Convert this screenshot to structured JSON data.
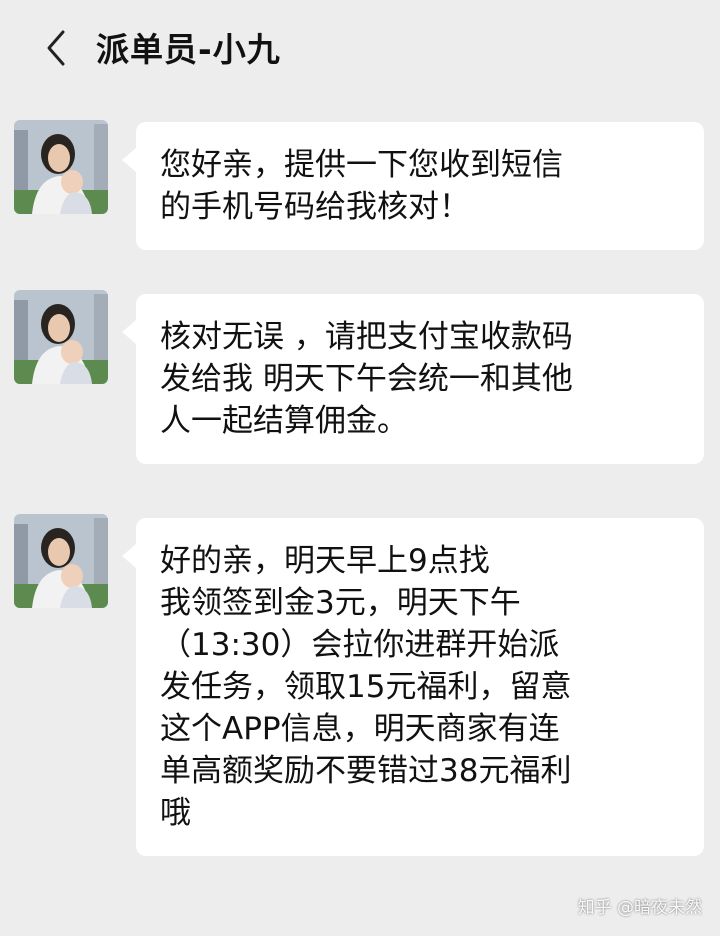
{
  "header": {
    "title": "派单员-小九",
    "back_icon": "chevron-left-icon"
  },
  "messages": [
    {
      "sender": "派单员-小九",
      "text": "您好亲，提供一下您收到短信\n的手机号码给我核对！"
    },
    {
      "sender": "派单员-小九",
      "text": "核对无误 ，请把支付宝收款码\n发给我  明天下午会统一和其他\n人一起结算佣金。"
    },
    {
      "sender": "派单员-小九",
      "text": "好的亲，明天早上9点找\n我领签到金3元，明天下午\n（13:30）会拉你进群开始派\n发任务，领取15元福利，留意\n这个APP信息，明天商家有连\n单高额奖励不要错过38元福利\n哦"
    }
  ],
  "watermark": "知乎 @暗夜未然",
  "colors": {
    "background": "#ededed",
    "bubble": "#ffffff",
    "text": "#111111"
  }
}
